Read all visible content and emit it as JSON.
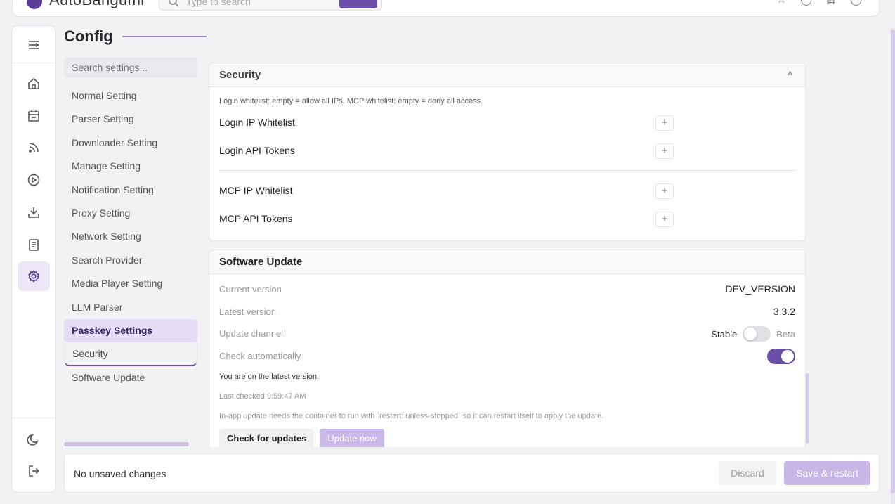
{
  "app": {
    "name": "AutoBangumi",
    "search_placeholder": "Type to search"
  },
  "page": {
    "title": "Config"
  },
  "settings_nav": {
    "search_placeholder": "Search settings...",
    "items": [
      {
        "label": "Normal Setting"
      },
      {
        "label": "Parser Setting"
      },
      {
        "label": "Downloader Setting"
      },
      {
        "label": "Manage Setting"
      },
      {
        "label": "Notification Setting"
      },
      {
        "label": "Proxy Setting"
      },
      {
        "label": "Network Setting"
      },
      {
        "label": "Search Provider"
      },
      {
        "label": "Media Player Setting"
      },
      {
        "label": "LLM Parser"
      },
      {
        "label": "Passkey Settings"
      },
      {
        "label": "Security"
      },
      {
        "label": "Software Update"
      }
    ]
  },
  "security": {
    "title": "Security",
    "note": "Login whitelist: empty = allow all IPs. MCP whitelist: empty = deny all access.",
    "rows": [
      {
        "label": "Login IP Whitelist",
        "add": "+"
      },
      {
        "label": "Login API Tokens",
        "add": "+"
      },
      {
        "label": "MCP IP Whitelist",
        "add": "+"
      },
      {
        "label": "MCP API Tokens",
        "add": "+"
      }
    ]
  },
  "update": {
    "title": "Software Update",
    "current_label": "Current version",
    "current_value": "DEV_VERSION",
    "latest_label": "Latest version",
    "latest_value": "3.3.2",
    "channel_label": "Update channel",
    "channel_stable": "Stable",
    "channel_beta": "Beta",
    "channel_is_beta": false,
    "auto_label": "Check automatically",
    "auto_enabled": true,
    "status_msg": "You are on the latest version.",
    "last_checked": "Last checked 9:59:47 AM",
    "restart_note": "In-app update needs the container to run with `restart: unless-stopped` so it can restart itself to apply the update.",
    "check_button": "Check for updates",
    "update_button": "Update now"
  },
  "footer": {
    "status": "No unsaved changes",
    "discard": "Discard",
    "save": "Save & restart"
  },
  "colors": {
    "accent": "#6a4fa8",
    "accent_light": "#e6dcf6",
    "disabled_accent": "#c7b6e6"
  },
  "rail_icons": [
    "menu-fold-icon",
    "home-icon",
    "calendar-icon",
    "rss-icon",
    "play-icon",
    "download-icon",
    "log-icon",
    "gear-icon",
    "moon-icon",
    "logout-icon"
  ]
}
